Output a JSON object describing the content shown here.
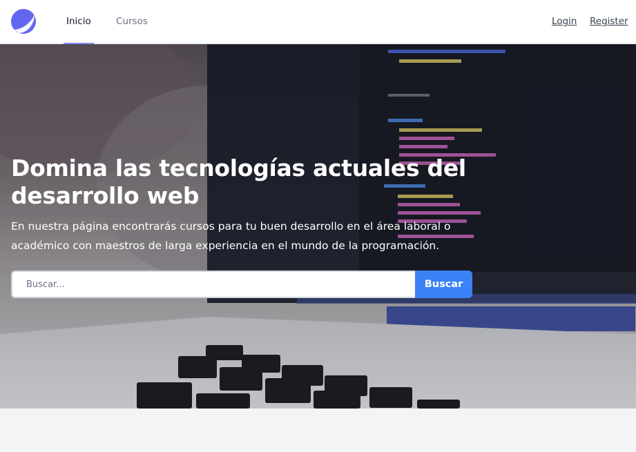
{
  "nav": {
    "logo": "logo-icon",
    "links": [
      {
        "label": "Inicio",
        "active": true
      },
      {
        "label": "Cursos",
        "active": false
      }
    ],
    "login": "Login",
    "register": "Register"
  },
  "hero": {
    "title": "Domina las tecnologías actuales del desarrollo web",
    "subtitle": "En nuestra página encontrarás cursos para tu buen desarrollo en el área laboral o académico con maestros de larga experiencia en el mundo de la programación.",
    "search": {
      "placeholder": "Buscar...",
      "value": "",
      "button": "Buscar"
    }
  },
  "colors": {
    "accent": "#3b82f6",
    "logo": "#6366f1",
    "active_indicator": "#818cf8",
    "page_bg": "#f3f4f6"
  }
}
